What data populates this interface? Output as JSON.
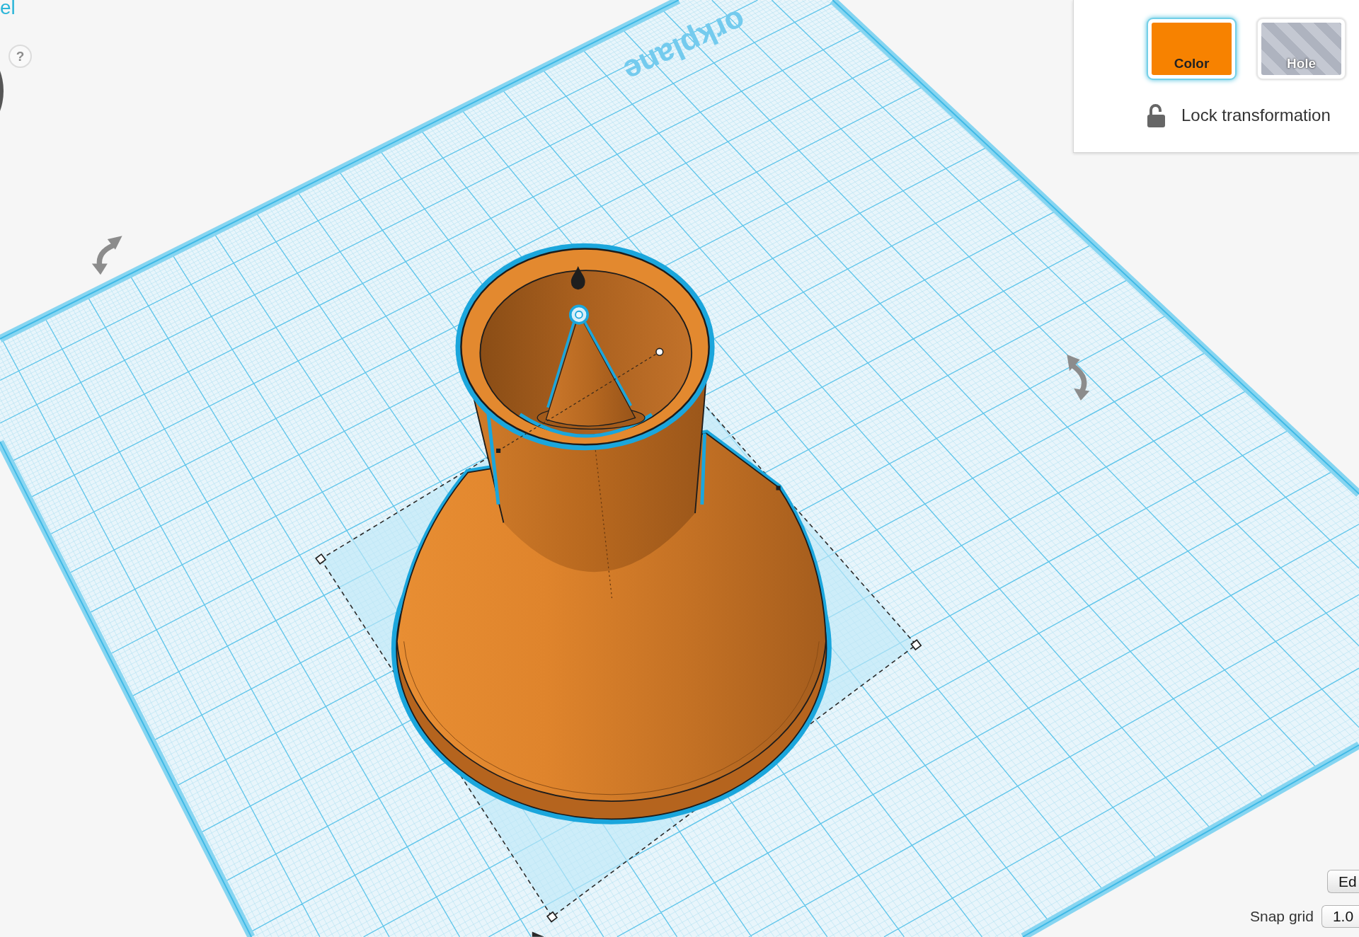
{
  "title": "el",
  "help_button": {
    "label": "?"
  },
  "workplane": {
    "label": "orkplane"
  },
  "shape_panel": {
    "options": [
      {
        "kind": "color",
        "label": "Color",
        "selected": true
      },
      {
        "kind": "hole",
        "label": "Hole",
        "selected": false
      }
    ],
    "lock": {
      "label": "Lock transformation",
      "locked": false
    }
  },
  "grid_controls": {
    "edit_button": {
      "label": "Ed"
    },
    "snap_grid": {
      "label": "Snap grid",
      "value": "1.0"
    }
  }
}
